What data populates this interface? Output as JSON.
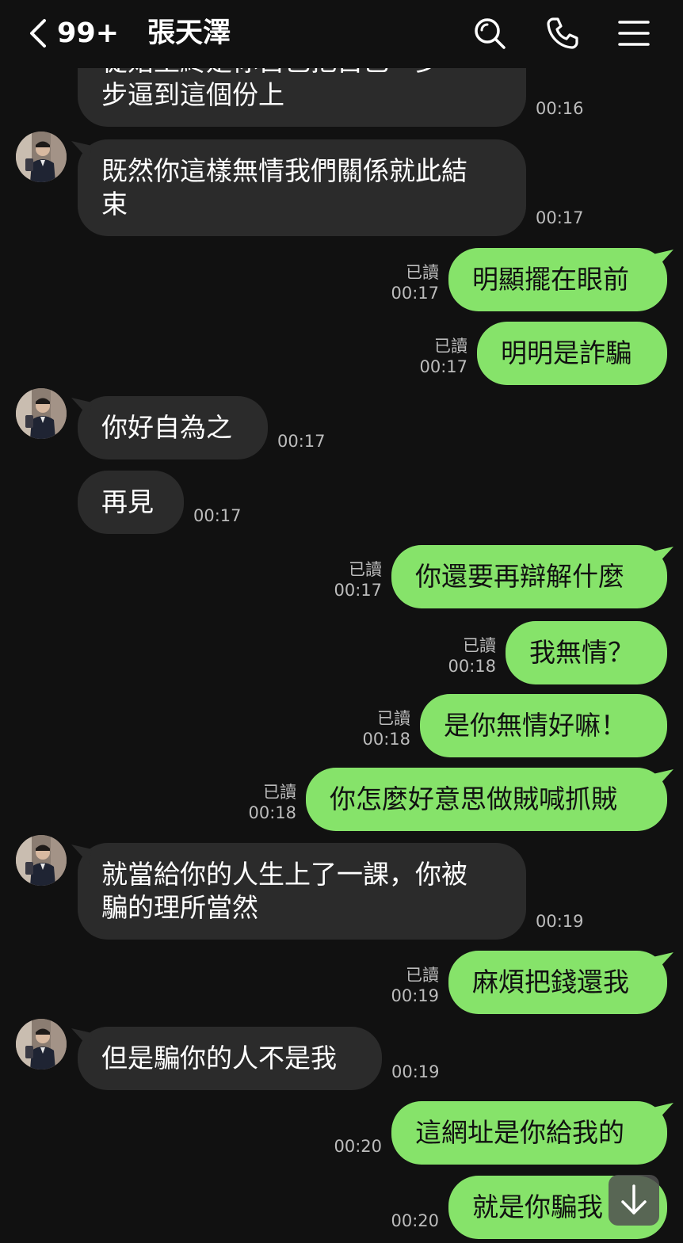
{
  "header": {
    "back_icon": "chevron-left-icon",
    "unread_badge": "99+",
    "contact_name": "張天澤",
    "search_icon": "search-icon",
    "call_icon": "phone-icon",
    "menu_icon": "menu-icon"
  },
  "colors": {
    "background": "#111111",
    "incoming_bubble": "#2b2b2b",
    "outgoing_bubble": "#86e36a",
    "meta_text": "#bcbcbc"
  },
  "messages": [
    {
      "side": "in",
      "lines": [
        "從始至終是你自己把自己一步一",
        "步逼到這個份上"
      ],
      "time": "00:16"
    },
    {
      "side": "in",
      "lines": [
        "既然你這樣無情我們關係就此結",
        "束"
      ],
      "time": "00:17"
    },
    {
      "side": "out",
      "lines": [
        "明顯擺在眼前"
      ],
      "read": "已讀",
      "time": "00:17"
    },
    {
      "side": "out",
      "lines": [
        "明明是詐騙"
      ],
      "read": "已讀",
      "time": "00:17"
    },
    {
      "side": "in",
      "lines": [
        "你好自為之"
      ],
      "time": "00:17"
    },
    {
      "side": "in",
      "lines": [
        "再見"
      ],
      "time": "00:17"
    },
    {
      "side": "out",
      "lines": [
        "你還要再辯解什麼"
      ],
      "read": "已讀",
      "time": "00:17"
    },
    {
      "side": "out",
      "lines": [
        "我無情？"
      ],
      "read": "已讀",
      "time": "00:18"
    },
    {
      "side": "out",
      "lines": [
        "是你無情好嘛！"
      ],
      "read": "已讀",
      "time": "00:18"
    },
    {
      "side": "out",
      "lines": [
        "你怎麼好意思做賊喊抓賊"
      ],
      "read": "已讀",
      "time": "00:18"
    },
    {
      "side": "in",
      "lines": [
        "就當給你的人生上了一課，你被",
        "騙的理所當然"
      ],
      "time": "00:19"
    },
    {
      "side": "out",
      "lines": [
        "麻煩把錢還我"
      ],
      "read": "已讀",
      "time": "00:19"
    },
    {
      "side": "in",
      "lines": [
        "但是騙你的人不是我"
      ],
      "time": "00:19"
    },
    {
      "side": "out",
      "lines": [
        "這網址是你給我的"
      ],
      "time": "00:20"
    },
    {
      "side": "out",
      "lines": [
        "就是你騙我"
      ],
      "time": "00:20"
    }
  ],
  "scroll_button_icon": "arrow-down-icon"
}
